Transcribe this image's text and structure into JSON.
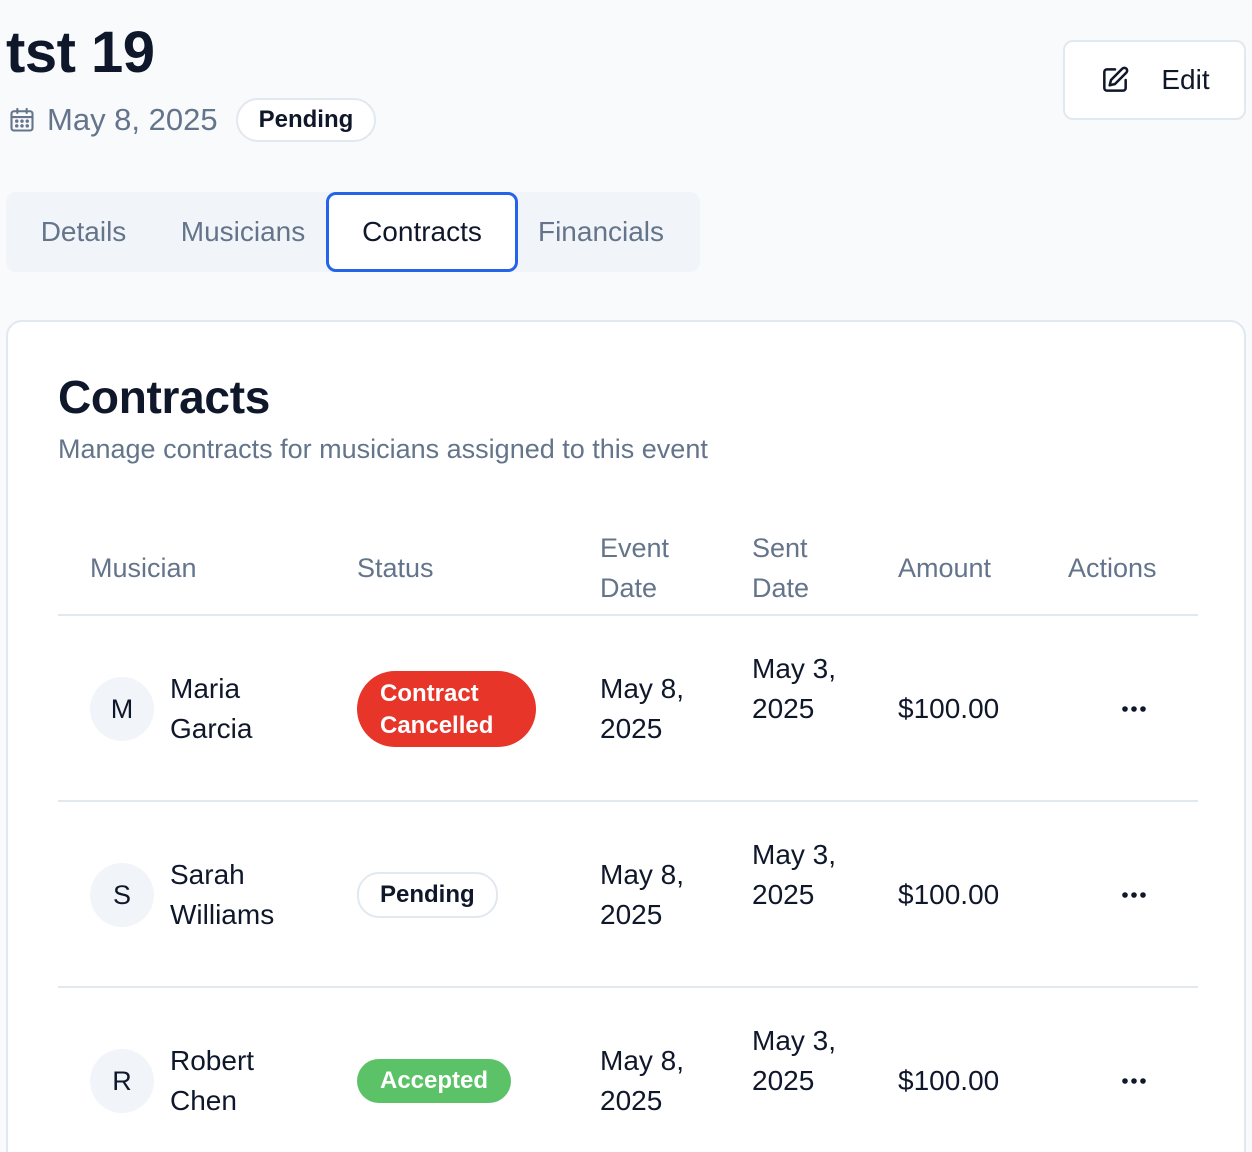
{
  "event": {
    "title": "tst 19",
    "date": "May 8, 2025",
    "status": "Pending"
  },
  "edit_button": {
    "label": "Edit"
  },
  "tabs": [
    {
      "label": "Details"
    },
    {
      "label": "Musicians"
    },
    {
      "label": "Contracts",
      "active": true
    },
    {
      "label": "Financials"
    }
  ],
  "contracts": {
    "title": "Contracts",
    "subtitle": "Manage contracts for musicians assigned to this event",
    "columns": {
      "musician": "Musician",
      "status": "Status",
      "event_date": "Event Date",
      "sent_date": "Sent Date",
      "amount": "Amount",
      "actions": "Actions"
    },
    "rows": [
      {
        "initial": "M",
        "name": "Maria Garcia",
        "status": "Contract Cancelled",
        "event_date": "May 8, 2025",
        "sent_date": "May 3, 2025",
        "amount": "$100.00"
      },
      {
        "initial": "S",
        "name": "Sarah Williams",
        "status": "Pending",
        "event_date": "May 8, 2025",
        "sent_date": "May 3, 2025",
        "amount": "$100.00"
      },
      {
        "initial": "R",
        "name": "Robert Chen",
        "status": "Accepted",
        "event_date": "May 8, 2025",
        "sent_date": "May 3, 2025",
        "amount": "$100.00"
      }
    ]
  },
  "colors": {
    "accent": "#2563eb",
    "cancelled": "#e8352a",
    "accepted": "#5cc268",
    "muted_text": "#64748b",
    "border": "#e2e8f0"
  },
  "icons": {
    "date": "calendar-icon",
    "edit": "edit-icon",
    "actions": "more-horizontal-icon"
  }
}
